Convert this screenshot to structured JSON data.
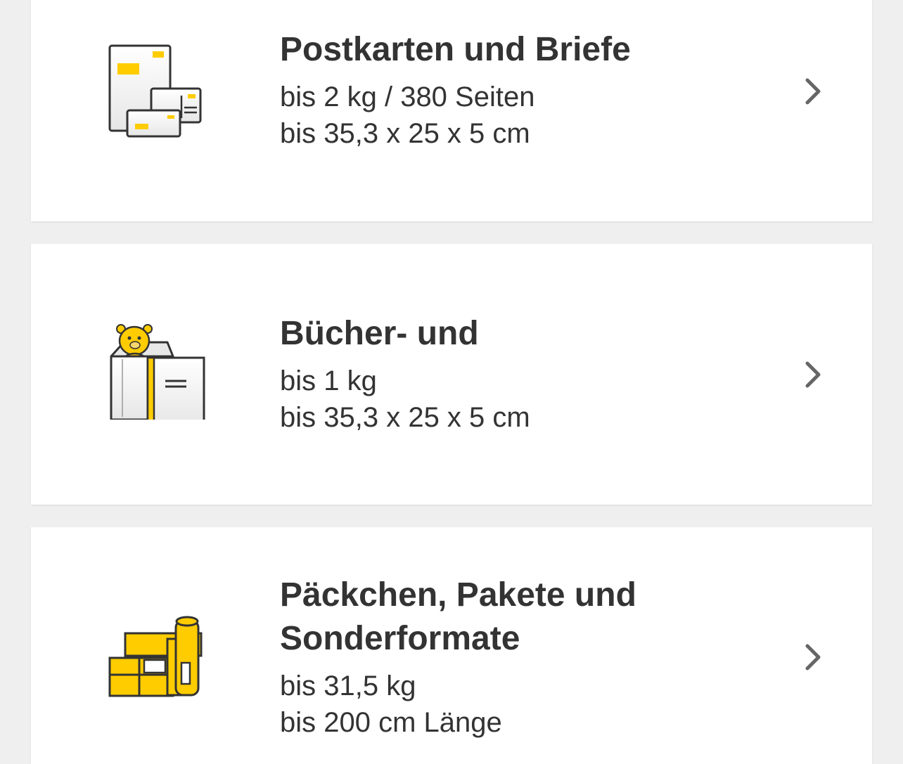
{
  "colors": {
    "background": "#efefef",
    "card": "#ffffff",
    "text": "#333333",
    "accent_yellow": "#ffcc00",
    "chevron": "#666666"
  },
  "categories": [
    {
      "title": "Postkarten und Briefe",
      "lines": [
        "bis 2 kg / 380 Seiten",
        "bis 35,3 x 25 x 5 cm"
      ],
      "icon": "letters-icon"
    },
    {
      "title": "Bücher- und",
      "lines": [
        "bis 1 kg",
        "bis 35,3 x 25 x 5 cm"
      ],
      "icon": "books-goods-icon"
    },
    {
      "title": "Päckchen, Pakete und Sonderformate",
      "lines": [
        "bis 31,5 kg",
        "bis 200 cm Länge"
      ],
      "icon": "parcels-icon"
    }
  ]
}
